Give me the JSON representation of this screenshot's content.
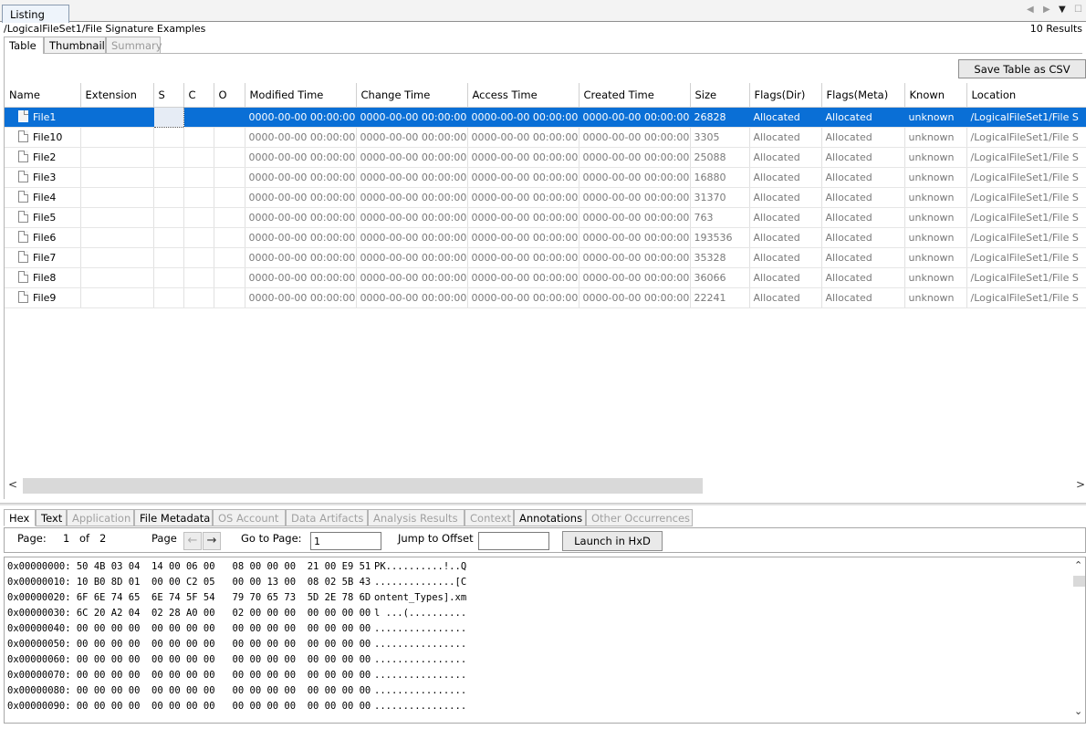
{
  "top": {
    "tab_label": "Listing",
    "path": "/LogicalFileSet1/File Signature Examples",
    "results": "10  Results"
  },
  "view_tabs": [
    {
      "label": "Table"
    },
    {
      "label": "Thumbnail"
    },
    {
      "label": "Summary"
    }
  ],
  "table": {
    "save_button": "Save Table as CSV",
    "columns": [
      "Name",
      "Extension",
      "S",
      "C",
      "O",
      "Modified Time",
      "Change Time",
      "Access Time",
      "Created Time",
      "Size",
      "Flags(Dir)",
      "Flags(Meta)",
      "Known",
      "Location"
    ],
    "rows": [
      {
        "name": "File1",
        "extension": "",
        "s": "",
        "c": "",
        "o": "",
        "modified": "0000-00-00 00:00:00",
        "change": "0000-00-00 00:00:00",
        "access": "0000-00-00 00:00:00",
        "created": "0000-00-00 00:00:00",
        "size": "26828",
        "flags_dir": "Allocated",
        "flags_meta": "Allocated",
        "known": "unknown",
        "location": "/LogicalFileSet1/File S"
      },
      {
        "name": "File10",
        "extension": "",
        "s": "",
        "c": "",
        "o": "",
        "modified": "0000-00-00 00:00:00",
        "change": "0000-00-00 00:00:00",
        "access": "0000-00-00 00:00:00",
        "created": "0000-00-00 00:00:00",
        "size": "3305",
        "flags_dir": "Allocated",
        "flags_meta": "Allocated",
        "known": "unknown",
        "location": "/LogicalFileSet1/File S"
      },
      {
        "name": "File2",
        "extension": "",
        "s": "",
        "c": "",
        "o": "",
        "modified": "0000-00-00 00:00:00",
        "change": "0000-00-00 00:00:00",
        "access": "0000-00-00 00:00:00",
        "created": "0000-00-00 00:00:00",
        "size": "25088",
        "flags_dir": "Allocated",
        "flags_meta": "Allocated",
        "known": "unknown",
        "location": "/LogicalFileSet1/File S"
      },
      {
        "name": "File3",
        "extension": "",
        "s": "",
        "c": "",
        "o": "",
        "modified": "0000-00-00 00:00:00",
        "change": "0000-00-00 00:00:00",
        "access": "0000-00-00 00:00:00",
        "created": "0000-00-00 00:00:00",
        "size": "16880",
        "flags_dir": "Allocated",
        "flags_meta": "Allocated",
        "known": "unknown",
        "location": "/LogicalFileSet1/File S"
      },
      {
        "name": "File4",
        "extension": "",
        "s": "",
        "c": "",
        "o": "",
        "modified": "0000-00-00 00:00:00",
        "change": "0000-00-00 00:00:00",
        "access": "0000-00-00 00:00:00",
        "created": "0000-00-00 00:00:00",
        "size": "31370",
        "flags_dir": "Allocated",
        "flags_meta": "Allocated",
        "known": "unknown",
        "location": "/LogicalFileSet1/File S"
      },
      {
        "name": "File5",
        "extension": "",
        "s": "",
        "c": "",
        "o": "",
        "modified": "0000-00-00 00:00:00",
        "change": "0000-00-00 00:00:00",
        "access": "0000-00-00 00:00:00",
        "created": "0000-00-00 00:00:00",
        "size": "763",
        "flags_dir": "Allocated",
        "flags_meta": "Allocated",
        "known": "unknown",
        "location": "/LogicalFileSet1/File S"
      },
      {
        "name": "File6",
        "extension": "",
        "s": "",
        "c": "",
        "o": "",
        "modified": "0000-00-00 00:00:00",
        "change": "0000-00-00 00:00:00",
        "access": "0000-00-00 00:00:00",
        "created": "0000-00-00 00:00:00",
        "size": "193536",
        "flags_dir": "Allocated",
        "flags_meta": "Allocated",
        "known": "unknown",
        "location": "/LogicalFileSet1/File S"
      },
      {
        "name": "File7",
        "extension": "",
        "s": "",
        "c": "",
        "o": "",
        "modified": "0000-00-00 00:00:00",
        "change": "0000-00-00 00:00:00",
        "access": "0000-00-00 00:00:00",
        "created": "0000-00-00 00:00:00",
        "size": "35328",
        "flags_dir": "Allocated",
        "flags_meta": "Allocated",
        "known": "unknown",
        "location": "/LogicalFileSet1/File S"
      },
      {
        "name": "File8",
        "extension": "",
        "s": "",
        "c": "",
        "o": "",
        "modified": "0000-00-00 00:00:00",
        "change": "0000-00-00 00:00:00",
        "access": "0000-00-00 00:00:00",
        "created": "0000-00-00 00:00:00",
        "size": "36066",
        "flags_dir": "Allocated",
        "flags_meta": "Allocated",
        "known": "unknown",
        "location": "/LogicalFileSet1/File S"
      },
      {
        "name": "File9",
        "extension": "",
        "s": "",
        "c": "",
        "o": "",
        "modified": "0000-00-00 00:00:00",
        "change": "0000-00-00 00:00:00",
        "access": "0000-00-00 00:00:00",
        "created": "0000-00-00 00:00:00",
        "size": "22241",
        "flags_dir": "Allocated",
        "flags_meta": "Allocated",
        "known": "unknown",
        "location": "/LogicalFileSet1/File S"
      }
    ],
    "selected_row": 0
  },
  "lower_tabs": [
    {
      "label": "Hex",
      "state": "active"
    },
    {
      "label": "Text",
      "state": "enabled"
    },
    {
      "label": "Application",
      "state": "disabled"
    },
    {
      "label": "File Metadata",
      "state": "enabled"
    },
    {
      "label": "OS Account",
      "state": "disabled"
    },
    {
      "label": "Data Artifacts",
      "state": "disabled"
    },
    {
      "label": "Analysis Results",
      "state": "disabled"
    },
    {
      "label": "Context",
      "state": "disabled"
    },
    {
      "label": "Annotations",
      "state": "enabled"
    },
    {
      "label": "Other Occurrences",
      "state": "disabled"
    }
  ],
  "hex_toolbar": {
    "page_label": "Page:",
    "page_current": "1",
    "of_label": "of",
    "page_total": "2",
    "page_nav_label": "Page",
    "goto_label": "Go to Page:",
    "goto_value": "1",
    "offset_label": "Jump to Offset",
    "offset_value": "",
    "launch_button": "Launch in HxD"
  },
  "hex_lines": [
    {
      "hex": "0x00000000: 50 4B 03 04  14 00 06 00   08 00 00 00  21 00 E9 51",
      "ascii": "PK..........!..Q"
    },
    {
      "hex": "0x00000010: 10 B0 8D 01  00 00 C2 05   00 00 13 00  08 02 5B 43",
      "ascii": "..............[C"
    },
    {
      "hex": "0x00000020: 6F 6E 74 65  6E 74 5F 54   79 70 65 73  5D 2E 78 6D",
      "ascii": "ontent_Types].xm"
    },
    {
      "hex": "0x00000030: 6C 20 A2 04  02 28 A0 00   02 00 00 00  00 00 00 00",
      "ascii": "l ...(.........."
    },
    {
      "hex": "0x00000040: 00 00 00 00  00 00 00 00   00 00 00 00  00 00 00 00",
      "ascii": "................"
    },
    {
      "hex": "0x00000050: 00 00 00 00  00 00 00 00   00 00 00 00  00 00 00 00",
      "ascii": "................"
    },
    {
      "hex": "0x00000060: 00 00 00 00  00 00 00 00   00 00 00 00  00 00 00 00",
      "ascii": "................"
    },
    {
      "hex": "0x00000070: 00 00 00 00  00 00 00 00   00 00 00 00  00 00 00 00",
      "ascii": "................"
    },
    {
      "hex": "0x00000080: 00 00 00 00  00 00 00 00   00 00 00 00  00 00 00 00",
      "ascii": "................"
    },
    {
      "hex": "0x00000090: 00 00 00 00  00 00 00 00   00 00 00 00  00 00 00 00",
      "ascii": "................"
    }
  ],
  "icons": {
    "file": "file-icon",
    "nav_back": "nav-back-icon",
    "nav_forward": "nav-forward-icon",
    "dropdown": "dropdown-icon",
    "maximize": "maximize-icon"
  },
  "colors": {
    "selection": "#0a6fd6"
  }
}
